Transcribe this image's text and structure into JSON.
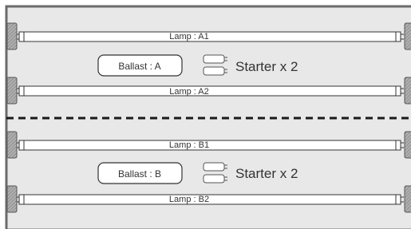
{
  "fixture_a": {
    "lamp_top_label": "Lamp : A1",
    "lamp_bottom_label": "Lamp : A2",
    "ballast_label": "Ballast : A",
    "starter_label": "Starter x 2"
  },
  "fixture_b": {
    "lamp_top_label": "Lamp : B1",
    "lamp_bottom_label": "Lamp : B2",
    "ballast_label": "Ballast : B",
    "starter_label": "Starter x 2"
  },
  "colors": {
    "housing_fill": "#e8e8e8",
    "housing_border": "#6b6b6b",
    "lamp_fill": "#ffffff",
    "outline": "#333333",
    "divider": "#1a1a1a",
    "socket_fill": "#9a9a9a"
  }
}
